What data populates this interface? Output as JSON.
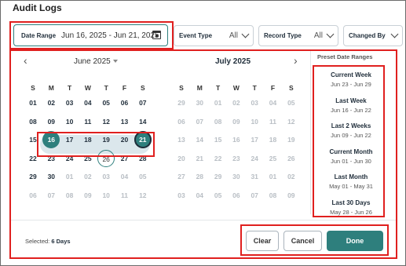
{
  "page": {
    "title": "Audit Logs"
  },
  "filters": {
    "date_range": {
      "label": "Date Range",
      "value": "Jun 16, 2025 - Jun 21, 2025"
    },
    "event_type": {
      "label": "Event Type",
      "value": "All"
    },
    "record_type": {
      "label": "Record Type",
      "value": "All"
    },
    "changed_by": {
      "label": "Changed By"
    }
  },
  "calendar": {
    "weekdays": [
      "S",
      "M",
      "T",
      "W",
      "T",
      "F",
      "S"
    ],
    "left": {
      "title": "June 2025",
      "weeks": [
        [
          "01",
          "02",
          "03",
          "04",
          "05",
          "06",
          "07"
        ],
        [
          "08",
          "09",
          "10",
          "11",
          "12",
          "13",
          "14"
        ],
        [
          "15",
          "16",
          "17",
          "18",
          "19",
          "20",
          "21"
        ],
        [
          "22",
          "23",
          "24",
          "25",
          "26",
          "27",
          "28"
        ],
        [
          "29",
          "30",
          "01",
          "02",
          "03",
          "04",
          "05"
        ],
        [
          "06",
          "07",
          "08",
          "09",
          "10",
          "11",
          "12"
        ]
      ]
    },
    "right": {
      "title": "July 2025",
      "weeks": [
        [
          "29",
          "30",
          "01",
          "02",
          "03",
          "04",
          "05"
        ],
        [
          "06",
          "07",
          "08",
          "09",
          "10",
          "11",
          "12"
        ],
        [
          "13",
          "14",
          "15",
          "16",
          "17",
          "18",
          "19"
        ],
        [
          "20",
          "21",
          "22",
          "23",
          "24",
          "25",
          "26"
        ],
        [
          "27",
          "28",
          "29",
          "30",
          "31",
          "01",
          "02"
        ],
        [
          "03",
          "04",
          "05",
          "06",
          "07",
          "08",
          "09"
        ]
      ]
    },
    "range_start": "16",
    "range_end": "21",
    "today": "26"
  },
  "presets": {
    "heading": "Preset Date Ranges",
    "items": [
      {
        "name": "Current Week",
        "dates": "Jun 23 - Jun 29"
      },
      {
        "name": "Last Week",
        "dates": "Jun 16 - Jun 22"
      },
      {
        "name": "Last 2 Weeks",
        "dates": "Jun 09 - Jun 22"
      },
      {
        "name": "Current Month",
        "dates": "Jun 01 - Jun 30"
      },
      {
        "name": "Last Month",
        "dates": "May 01 - May 31"
      },
      {
        "name": "Last 30 Days",
        "dates": "May 28 - Jun 26"
      }
    ]
  },
  "footer": {
    "selected_label": "Selected:",
    "selected_value": "6 Days",
    "clear_label": "Clear",
    "cancel_label": "Cancel",
    "done_label": "Done"
  },
  "colors": {
    "accent": "#2e7f7d",
    "range_fill": "#dbe7ec",
    "annotation": "#e0201f"
  }
}
